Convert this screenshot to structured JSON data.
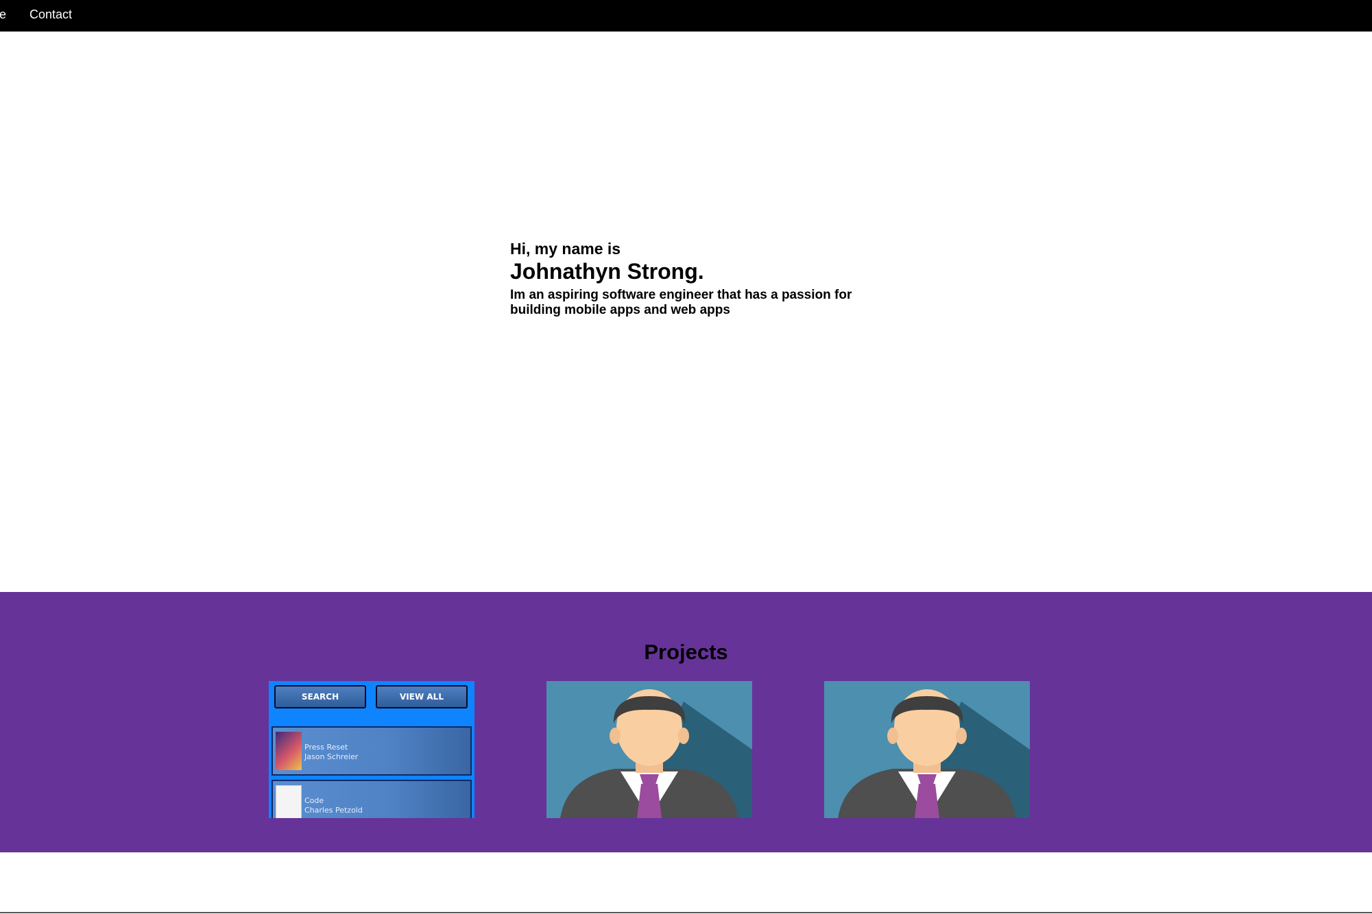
{
  "nav": {
    "partial_label": "ce",
    "contact_label": "Contact"
  },
  "hero": {
    "greeting": "Hi, my name is",
    "name": "Johnathyn Strong.",
    "tagline": "Im an aspiring software engineer that has a passion for building mobile apps and web apps"
  },
  "projects": {
    "title": "Projects",
    "app_mock": {
      "search_label": "SEARCH",
      "view_all_label": "VIEW ALL",
      "books": [
        {
          "title": "Press Reset",
          "author": "Jason Schreier"
        },
        {
          "title": "Code",
          "author": "Charles Petzold"
        }
      ]
    }
  },
  "colors": {
    "nav_bg": "#000000",
    "projects_bg": "#663399",
    "app_bg": "#0f84ff"
  }
}
